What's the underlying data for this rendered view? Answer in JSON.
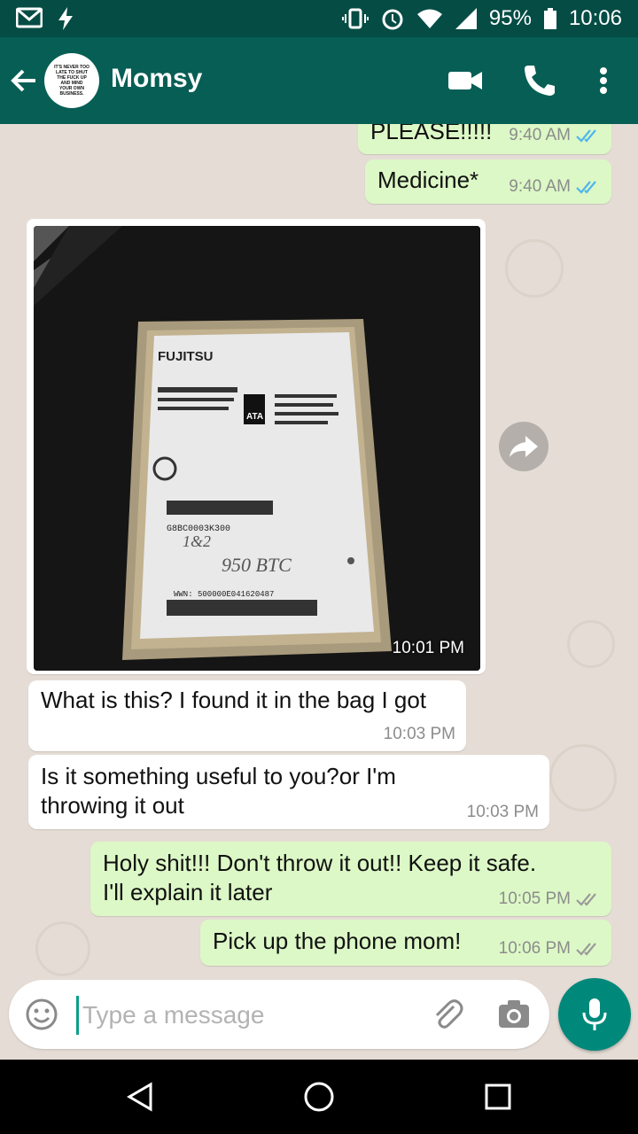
{
  "status_bar": {
    "battery": "95%",
    "time": "10:06"
  },
  "header": {
    "contact_name": "Momsy",
    "avatar_text": "IT'S NEVER TOO LATE TO SHUT THE FUCK UP AND MIND YOUR OWN BUSINESS."
  },
  "messages": [
    {
      "direction": "out",
      "text": "PLEASE!!!!!",
      "time": "9:40 AM",
      "status": "read"
    },
    {
      "direction": "out",
      "text": "Medicine*",
      "time": "9:40 AM",
      "status": "read"
    },
    {
      "direction": "in",
      "type": "image",
      "time": "10:01 PM",
      "image_text": {
        "brand": "FUJITSU",
        "interface": "ATA",
        "handwriting_1": "1&2",
        "handwriting_2": "950 BTC",
        "part": "G8BC0003K300",
        "wwn": "WWN: 500000E041620487"
      }
    },
    {
      "direction": "in",
      "text": "What is this? I found it in the bag I got",
      "time": "10:03 PM"
    },
    {
      "direction": "in",
      "text_lines": [
        "Is it something useful to you?or I'm",
        "throwing it out"
      ],
      "time": "10:03 PM"
    },
    {
      "direction": "out",
      "text_lines": [
        "Holy shit!!! Don't throw it out!! Keep it safe.",
        "I'll explain it later"
      ],
      "time": "10:05 PM",
      "status": "delivered"
    },
    {
      "direction": "out",
      "text": "Pick up the phone mom!",
      "time": "10:06 PM",
      "status": "delivered"
    }
  ],
  "composer": {
    "placeholder": "Type a message"
  },
  "colors": {
    "header": "#075e54",
    "status_bar": "#044c44",
    "outgoing": "#dcf8c6",
    "incoming": "#ffffff",
    "accent": "#00897b",
    "read_tick": "#4fb6ec"
  },
  "icons": [
    "gmail-icon",
    "flash-icon",
    "vibrate-icon",
    "alarm-icon",
    "wifi-icon",
    "signal-icon",
    "battery-icon",
    "back-arrow-icon",
    "video-call-icon",
    "phone-icon",
    "more-vert-icon",
    "forward-icon",
    "emoji-icon",
    "attach-icon",
    "camera-icon",
    "mic-icon",
    "nav-back-icon",
    "nav-home-icon",
    "nav-recents-icon"
  ]
}
